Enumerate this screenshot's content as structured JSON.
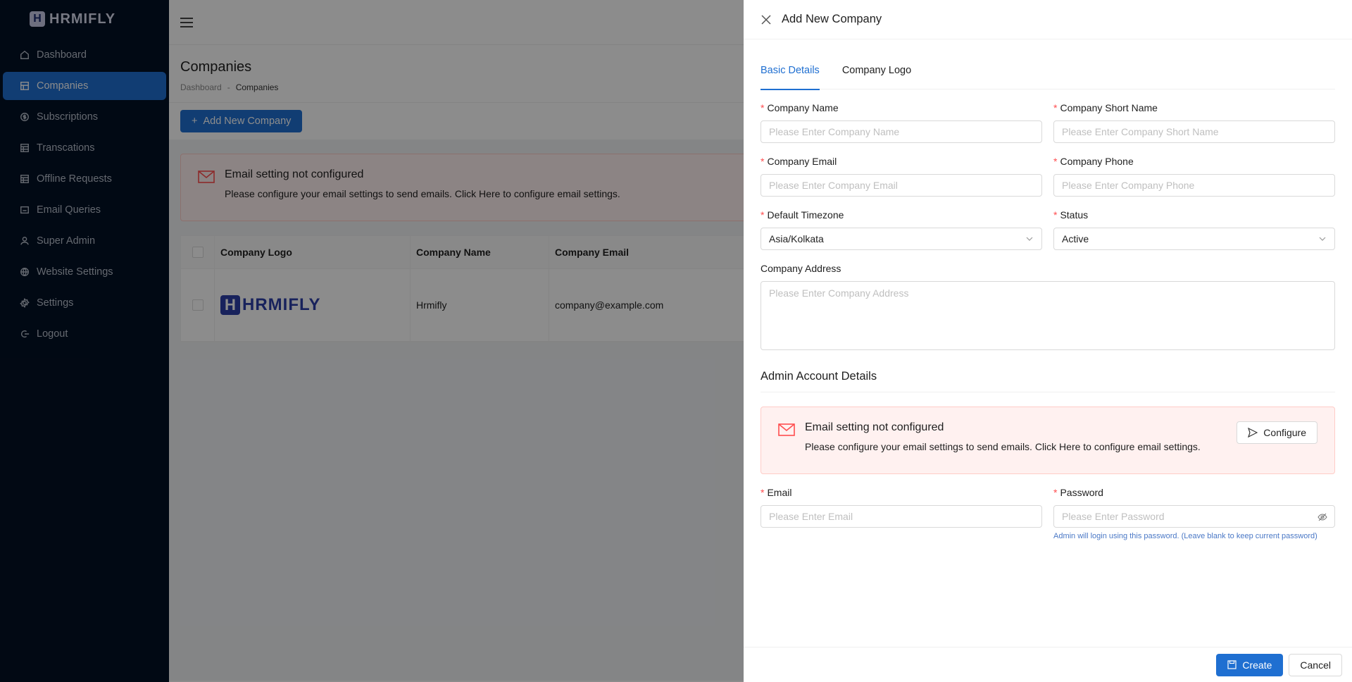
{
  "app": {
    "logo_text": "HRMIFLY",
    "logo_letter": "H"
  },
  "sidebar": {
    "items": [
      {
        "label": "Dashboard",
        "icon": "home-icon"
      },
      {
        "label": "Companies",
        "icon": "building-icon",
        "active": true
      },
      {
        "label": "Subscriptions",
        "icon": "dollar-icon"
      },
      {
        "label": "Transcations",
        "icon": "table-icon"
      },
      {
        "label": "Offline Requests",
        "icon": "table-icon"
      },
      {
        "label": "Email Queries",
        "icon": "mail-icon"
      },
      {
        "label": "Super Admin",
        "icon": "user-icon"
      },
      {
        "label": "Website Settings",
        "icon": "globe-icon"
      },
      {
        "label": "Settings",
        "icon": "gear-icon"
      },
      {
        "label": "Logout",
        "icon": "logout-icon"
      }
    ]
  },
  "page": {
    "title": "Companies",
    "breadcrumb": [
      "Dashboard",
      "Companies"
    ],
    "add_button": "Add New Company",
    "alert": {
      "title": "Email setting not configured",
      "desc": "Please configure your email settings to send emails. Click Here to configure email settings."
    },
    "table": {
      "headers": [
        "Company Logo",
        "Company Name",
        "Company Email"
      ],
      "rows": [
        {
          "logo_text": "HRMIFLY",
          "name": "Hrmifly",
          "email": "company@example.com"
        }
      ]
    }
  },
  "drawer": {
    "title": "Add New Company",
    "tabs": [
      "Basic Details",
      "Company Logo"
    ],
    "fields": {
      "company_name": {
        "label": "Company Name",
        "placeholder": "Please Enter Company Name"
      },
      "company_short_name": {
        "label": "Company Short Name",
        "placeholder": "Please Enter Company Short Name"
      },
      "company_email": {
        "label": "Company Email",
        "placeholder": "Please Enter Company Email"
      },
      "company_phone": {
        "label": "Company Phone",
        "placeholder": "Please Enter Company Phone"
      },
      "timezone": {
        "label": "Default Timezone",
        "value": "Asia/Kolkata"
      },
      "status": {
        "label": "Status",
        "value": "Active"
      },
      "address": {
        "label": "Company Address",
        "placeholder": "Please Enter Company Address"
      },
      "email": {
        "label": "Email",
        "placeholder": "Please Enter Email"
      },
      "password": {
        "label": "Password",
        "placeholder": "Please Enter Password",
        "hint": "Admin will login using this password. (Leave blank to keep current password)"
      }
    },
    "admin_section": "Admin Account Details",
    "alert": {
      "title": "Email setting not configured",
      "desc": "Please configure your email settings to send emails. Click Here to configure email settings.",
      "button": "Configure"
    },
    "footer": {
      "create": "Create",
      "cancel": "Cancel"
    }
  },
  "colors": {
    "primary": "#1f6fd1",
    "sidebar_bg": "#031125",
    "alert_bg": "#fff1f0",
    "required": "#ff4d4f"
  }
}
